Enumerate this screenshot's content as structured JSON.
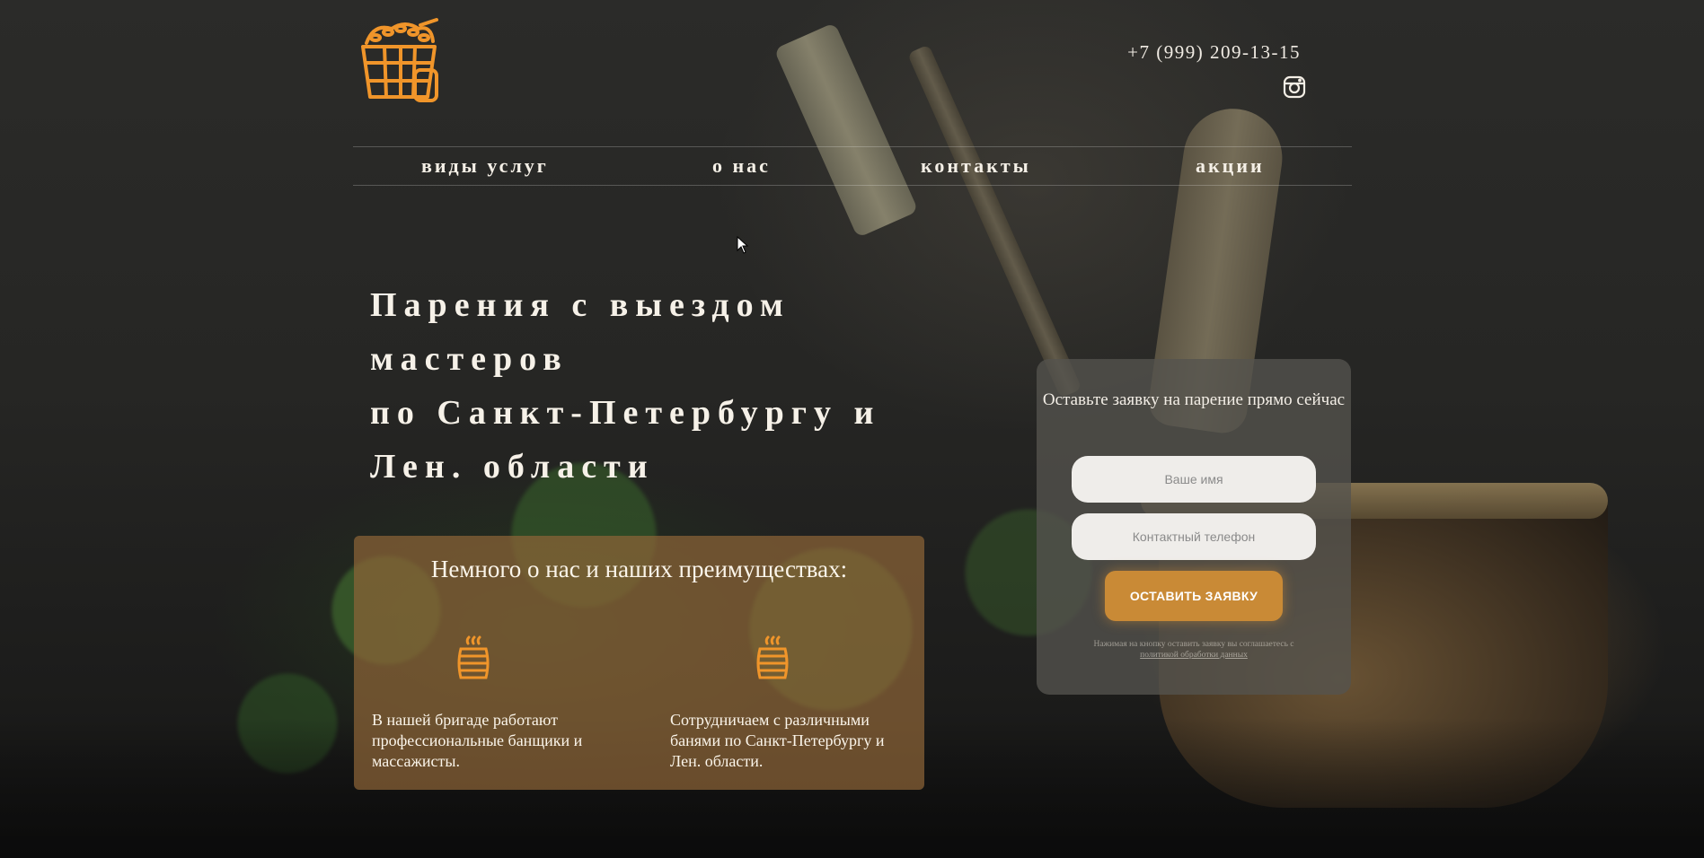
{
  "header": {
    "phone": "+7 (999) 209-13-15",
    "logo_icon": "bucket-with-bath-broom-icon",
    "social_icon": "instagram-icon"
  },
  "nav": {
    "items": [
      "виды услуг",
      "о нас",
      "контакты",
      "акции"
    ]
  },
  "hero": {
    "title_lines": [
      "Парения с выездом",
      "мастеров",
      "по Санкт-Петербургу и",
      "Лен. области"
    ]
  },
  "about": {
    "title": "Немного о нас и наших преимуществах:",
    "features": [
      {
        "icon": "barrel-icon",
        "text": "В нашей бригаде работают профессиональные банщики и массажисты."
      },
      {
        "icon": "barrel-icon",
        "text": "Сотрудничаем с различными банями по Санкт-Петербургу и Лен. области."
      }
    ]
  },
  "form": {
    "title": "Оставьте заявку на парение прямо сейчас",
    "name_placeholder": "Ваше имя",
    "phone_placeholder": "Контактный телефон",
    "submit_label": "ОСТАВИТЬ ЗАЯВКУ",
    "disclaimer": "Нажимая на кнопку оставить заявку вы соглашаетесь с",
    "policy_link": "политикой обработки данных"
  },
  "colors": {
    "accent": "#c98a36",
    "icon_orange": "#f0952a",
    "panel_brown": "#8c6437"
  }
}
